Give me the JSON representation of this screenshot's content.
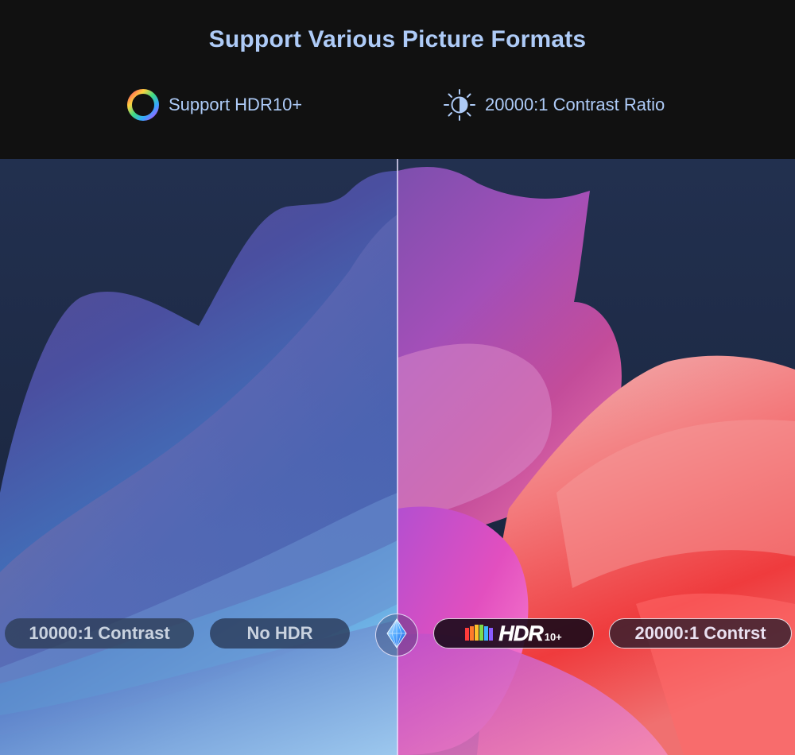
{
  "header": {
    "title": "Support Various Picture Formats",
    "features": [
      {
        "icon": "color-ring-icon",
        "label": "Support HDR10+"
      },
      {
        "icon": "contrast-sun-icon",
        "label": "20000:1 Contrast Ratio"
      }
    ]
  },
  "comparison": {
    "left_labels": [
      "10000:1 Contrast",
      "No HDR"
    ],
    "center_icon": "diamond-gem-icon",
    "right_logo": {
      "icon": "hdr10-plus-logo",
      "text": "HDR",
      "suffix": "10+"
    },
    "right_label": "20000:1 Contrst"
  },
  "colors": {
    "header_bg": "#111111",
    "title_text": "#aecbf7",
    "image_bg": "#1d2a45",
    "divider": "#ebe1ff"
  }
}
